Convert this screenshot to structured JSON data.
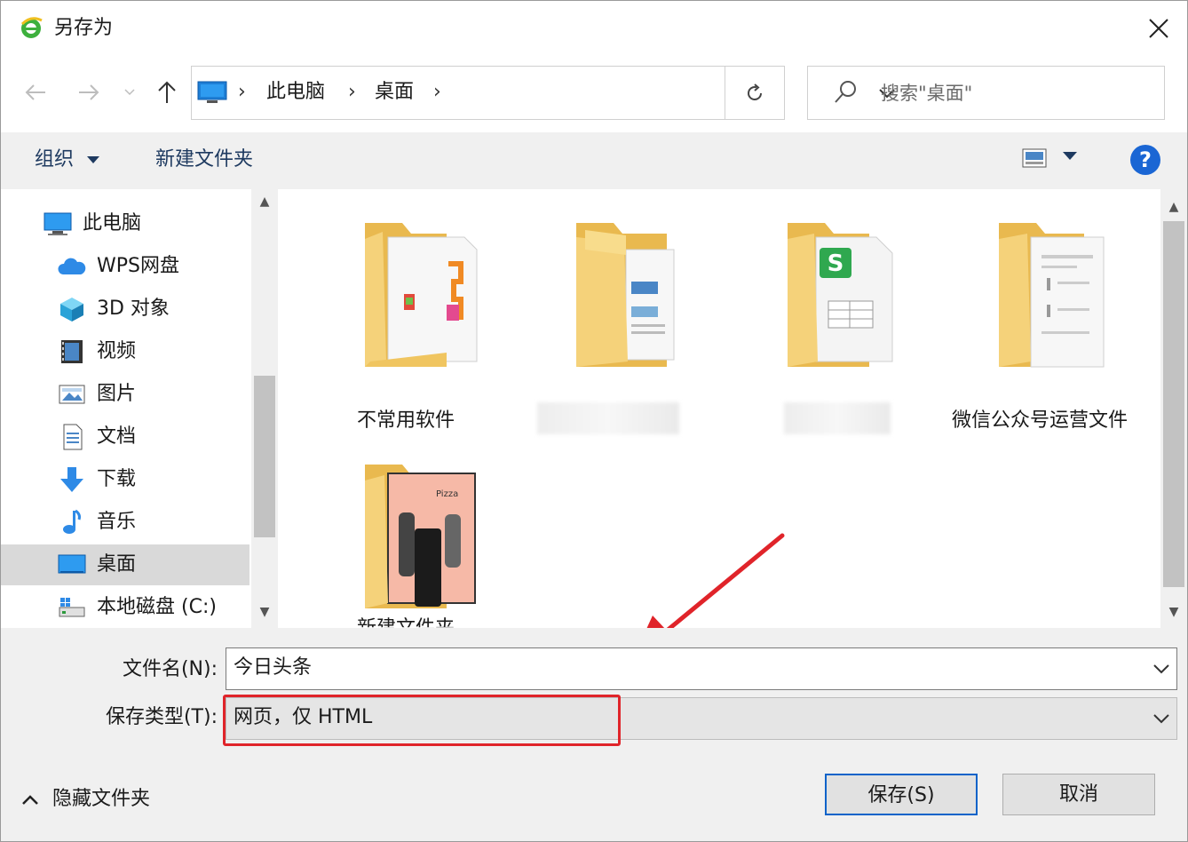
{
  "window": {
    "title": "另存为"
  },
  "address": {
    "crumbs": [
      "此电脑",
      "桌面"
    ],
    "search_placeholder": "搜索\"桌面\""
  },
  "toolbar": {
    "organize": "组织",
    "new_folder": "新建文件夹",
    "help": "?"
  },
  "nav": {
    "items": [
      {
        "label": "此电脑",
        "icon": "computer-icon"
      },
      {
        "label": "WPS网盘",
        "icon": "cloud-icon"
      },
      {
        "label": "3D 对象",
        "icon": "cube-icon"
      },
      {
        "label": "视频",
        "icon": "video-icon"
      },
      {
        "label": "图片",
        "icon": "picture-icon"
      },
      {
        "label": "文档",
        "icon": "document-icon"
      },
      {
        "label": "下载",
        "icon": "download-icon"
      },
      {
        "label": "音乐",
        "icon": "music-icon"
      },
      {
        "label": "桌面",
        "icon": "desktop-icon",
        "selected": true
      },
      {
        "label": "本地磁盘 (C:)",
        "icon": "drive-icon"
      }
    ]
  },
  "files": [
    {
      "label": "不常用软件"
    },
    {
      "label": ""
    },
    {
      "label": ""
    },
    {
      "label": "微信公众号运营文件"
    },
    {
      "label": "新建文件夹"
    }
  ],
  "form": {
    "filename_label": "文件名(N):",
    "filename_value": "今日头条",
    "filetype_label": "保存类型(T):",
    "filetype_value": "网页，仅 HTML",
    "hide_folders": "隐藏文件夹",
    "save": "保存(S)",
    "cancel": "取消"
  },
  "colors": {
    "accent_blue": "#1a66d4",
    "highlight_red": "#e0242a",
    "folder_yellow": "#f5d27a"
  }
}
